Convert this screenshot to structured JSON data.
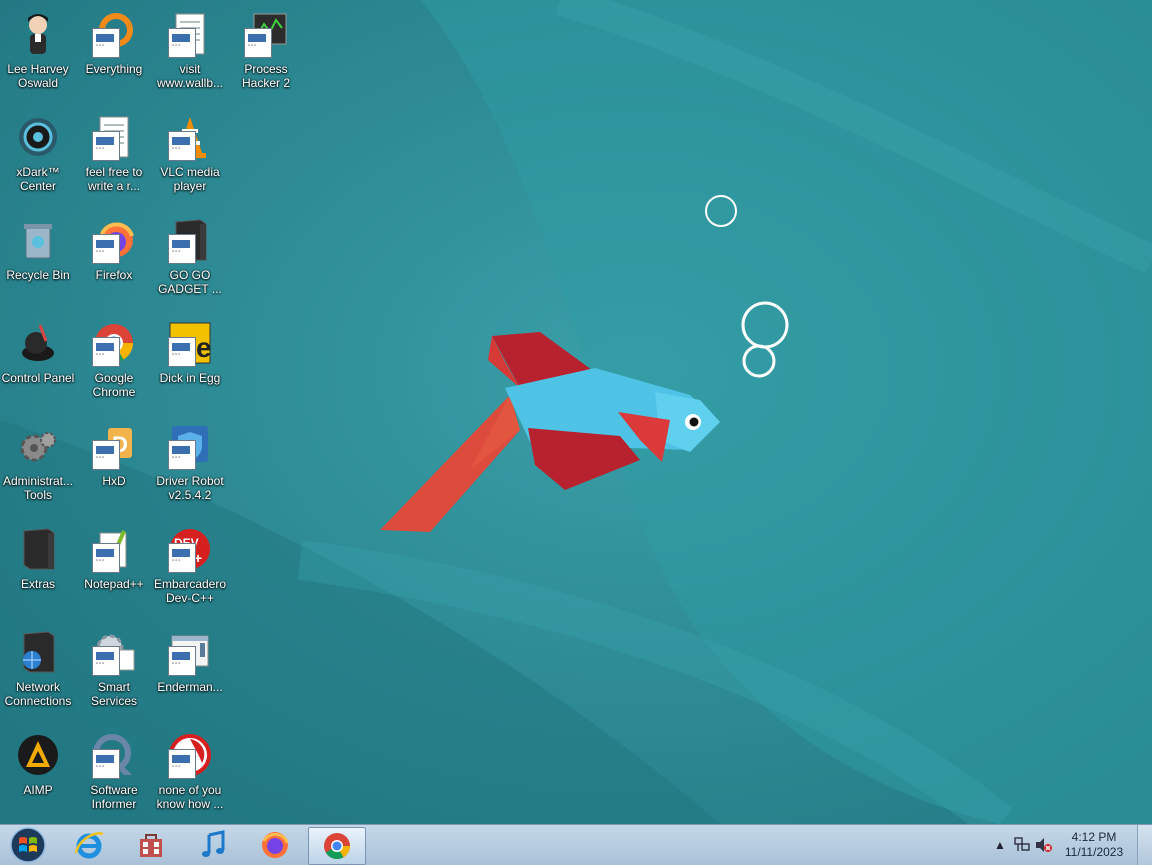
{
  "desktop": {
    "icons": [
      {
        "label": "Lee Harvey Oswald",
        "icon": "person-avatar-icon"
      },
      {
        "label": "Everything",
        "icon": "everything-search-icon"
      },
      {
        "label": "visit www.wallb...",
        "icon": "text-document-icon"
      },
      {
        "label": "Process Hacker 2",
        "icon": "process-hacker-icon"
      },
      {
        "label": "xDark™ Center",
        "icon": "xdark-center-icon"
      },
      {
        "label": "feel free to write a r...",
        "icon": "text-document-icon"
      },
      {
        "label": "VLC media player",
        "icon": "vlc-cone-icon"
      },
      {
        "label": "Recycle Bin",
        "icon": "recycle-bin-icon"
      },
      {
        "label": "Firefox",
        "icon": "firefox-icon"
      },
      {
        "label": "GO GO GADGET ...",
        "icon": "dark-folder-icon"
      },
      {
        "label": "Control Panel",
        "icon": "control-panel-icon"
      },
      {
        "label": "Google Chrome",
        "icon": "chrome-icon"
      },
      {
        "label": "Dick in Egg",
        "icon": "dick-in-egg-icon"
      },
      {
        "label": "Administrat... Tools",
        "icon": "admin-tools-gear-icon"
      },
      {
        "label": "HxD",
        "icon": "hxd-hex-editor-icon"
      },
      {
        "label": "Driver Robot v2.5.4.2",
        "icon": "driver-robot-shield-icon"
      },
      {
        "label": "Extras",
        "icon": "dark-folder-icon"
      },
      {
        "label": "Notepad++",
        "icon": "notepad-plus-plus-icon"
      },
      {
        "label": "Embarcadero Dev-C++",
        "icon": "dev-cpp-icon"
      },
      {
        "label": "Network Connections",
        "icon": "network-connections-icon"
      },
      {
        "label": "Smart Services",
        "icon": "smart-services-gear-icon"
      },
      {
        "label": "Enderman...",
        "icon": "window-app-icon"
      },
      {
        "label": "AIMP",
        "icon": "aimp-player-icon"
      },
      {
        "label": "Software Informer",
        "icon": "software-informer-icon"
      },
      {
        "label": "none of you know how ...",
        "icon": "red-circle-app-icon"
      }
    ]
  },
  "taskbar": {
    "pinned": [
      {
        "name": "internet-explorer",
        "icon": "internet-explorer-icon"
      },
      {
        "name": "store",
        "icon": "store-bag-icon"
      },
      {
        "name": "itunes",
        "icon": "music-note-icon"
      },
      {
        "name": "firefox",
        "icon": "firefox-icon"
      },
      {
        "name": "chrome",
        "icon": "chrome-icon"
      }
    ],
    "tray": {
      "overflow_icon": "up-arrow-icon",
      "network_icon": "network-icon",
      "volume_icon": "volume-muted-icon",
      "time": "4:12 PM",
      "date": "11/11/2023"
    }
  },
  "colors": {
    "wallpaper": "#2e8f98",
    "fish_body": "#4fc3e6",
    "fish_fin_red": "#b7222e",
    "fish_tail": "#dc4b3b"
  }
}
